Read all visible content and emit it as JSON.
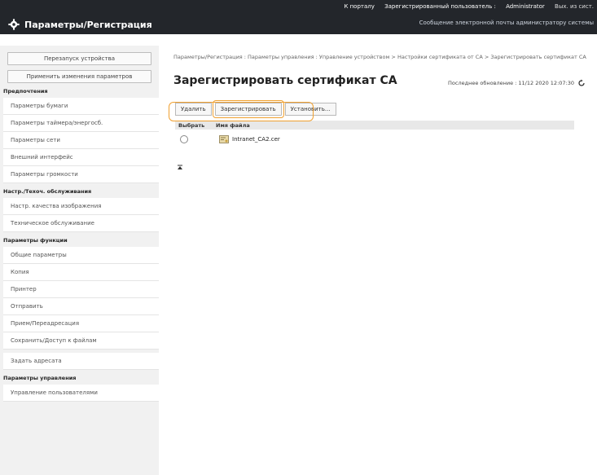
{
  "header": {
    "links": [
      "К порталу",
      "Зарегистрированный пользователь :",
      "Administrator",
      "Вых. из сист."
    ],
    "app_title": "Параметры/Регистрация",
    "mail_link": "Сообщение электронной почты администратору системы"
  },
  "sidebar": {
    "restart_button": "Перезапуск устройства",
    "apply_button": "Применить изменения параметров",
    "sections": [
      {
        "title": "Предпочтения",
        "items": [
          "Параметры бумаги",
          "Параметры таймера/энергосб.",
          "Параметры сети",
          "Внешний интерфейс",
          "Параметры громкости"
        ]
      },
      {
        "title": "Настр./Техоч. обслуживания",
        "items": [
          "Настр. качества изображения",
          "Техническое обслуживание"
        ]
      },
      {
        "title": "Параметры функции",
        "items": [
          "Общие параметры",
          "Копия",
          "Принтер",
          "Отправить",
          "Прием/Переадресация",
          "Сохранить/Доступ к файлам"
        ]
      },
      {
        "title": "",
        "items": [
          "Задать адресата"
        ]
      },
      {
        "title": "Параметры управления",
        "items": [
          "Управление пользователями"
        ]
      }
    ]
  },
  "main": {
    "breadcrumb": "Параметры/Регистрация : Параметры управления : Управление устройством > Настройки сертификата от CA > Зарегистрировать сертификат CA",
    "title": "Зарегистрировать сертификат CA",
    "last_update": "Последнее обновление : 11/12 2020 12:07:30",
    "toolbar": {
      "delete": "Удалить",
      "register": "Зарегистрировать",
      "install": "Установить..."
    },
    "table": {
      "headers": [
        "Выбрать",
        "Имя файла"
      ],
      "rows": [
        {
          "file_name": "Intranet_CA2.cer"
        }
      ]
    }
  },
  "colors": {
    "topbar": "#23262b",
    "highlight": "#f0a030",
    "sidebar_bg": "#f1f1f1"
  }
}
